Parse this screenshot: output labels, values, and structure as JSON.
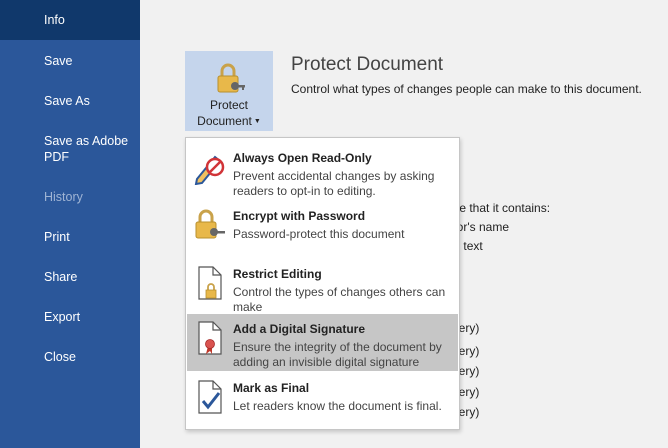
{
  "sidebar": {
    "items": [
      {
        "label": "Info",
        "state": "active"
      },
      {
        "label": "Save"
      },
      {
        "label": "Save As"
      },
      {
        "label": "Save as Adobe PDF"
      },
      {
        "label": "History",
        "state": "disabled"
      },
      {
        "label": "Print"
      },
      {
        "label": "Share"
      },
      {
        "label": "Export"
      },
      {
        "label": "Close"
      }
    ]
  },
  "protect": {
    "button_line1": "Protect",
    "button_line2": "Document",
    "title": "Protect Document",
    "description": "Control what types of changes people can make to this document."
  },
  "background_fragments": [
    "ware that it contains:",
    "uthor's name",
    "den text",
    "covery)",
    "covery)",
    "covery)",
    "covery)",
    "covery)"
  ],
  "menu": {
    "items": [
      {
        "title": "Always Open Read-Only",
        "description": "Prevent accidental changes by asking readers to opt-in to editing.",
        "icon": "read-only-pencil-icon"
      },
      {
        "title": "Encrypt with Password",
        "description": "Password-protect this document",
        "icon": "lock-key-icon"
      },
      {
        "title": "Restrict Editing",
        "description": "Control the types of changes others can make",
        "icon": "document-lock-icon"
      },
      {
        "title": "Add a Digital Signature",
        "description": "Ensure the integrity of the document by adding an invisible digital signature",
        "icon": "document-ribbon-icon",
        "state": "highlighted"
      },
      {
        "title": "Mark as Final",
        "description": "Let readers know the document is final.",
        "icon": "document-check-icon"
      }
    ]
  },
  "colors": {
    "sidebar": "#2b579a",
    "sidebar_active": "#10386b",
    "button_bg": "#c5d5ec",
    "highlight": "#c6c6c6"
  }
}
